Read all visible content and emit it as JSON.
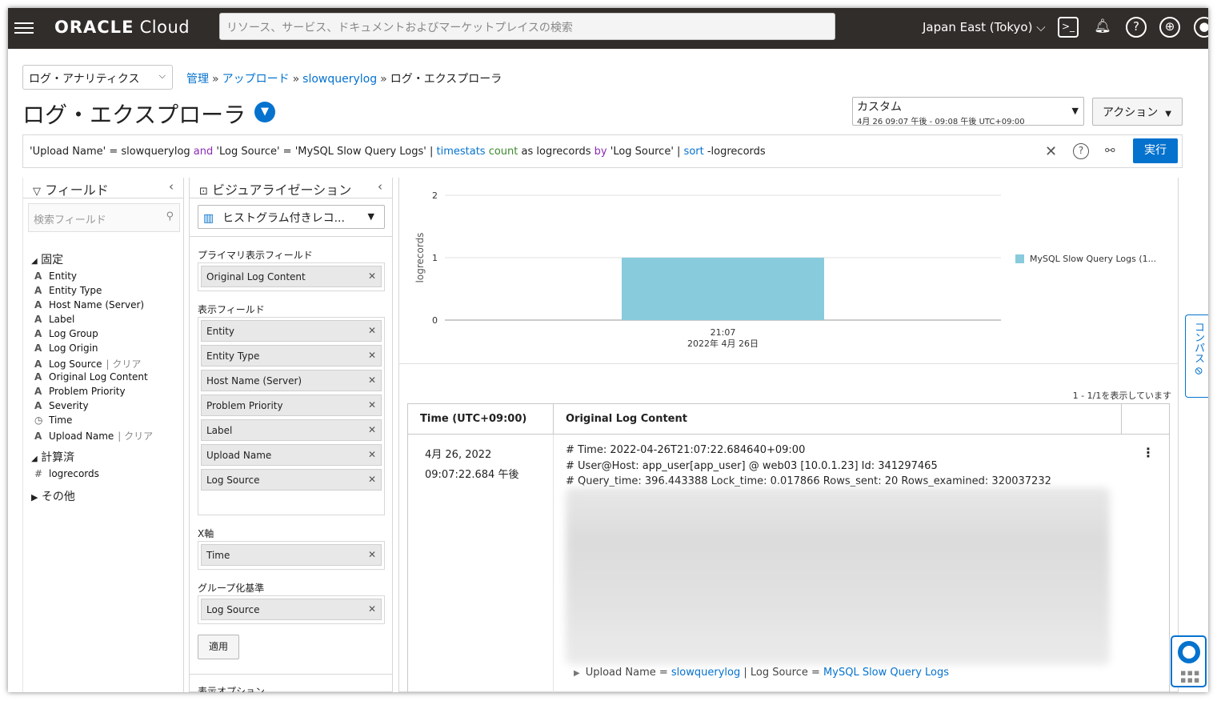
{
  "topbar": {
    "brand_bold": "ORACLE",
    "brand_rest": " Cloud",
    "search_placeholder": "リソース、サービス、ドキュメントおよびマーケットプレイスの検索",
    "region": "Japan East (Tokyo)",
    "icons": [
      "menu-icon",
      "cloud-shell-icon",
      "bell-icon",
      "help-icon",
      "globe-icon",
      "profile-icon"
    ]
  },
  "domain_select": "ログ・アナリティクス",
  "breadcrumb": {
    "items": [
      "管理",
      "アップロード",
      "slowquerylog"
    ],
    "current": "ログ・エクスプローラ",
    "separator": "»"
  },
  "page_title": "ログ・エクスプローラ",
  "time_range": {
    "label": "カスタム",
    "value": "4月 26 09:07 午後 - 09:08 午後 UTC+09:00"
  },
  "actions_label": "アクション",
  "query": {
    "p1": "'Upload Name' = slowquerylog ",
    "and": "and",
    "p2": " 'Log Source' = 'MySQL Slow Query Logs' | ",
    "timestats": "timestats",
    "count": "count",
    "as": " as ",
    "p3": "logrecords ",
    "by": "by",
    "p4": " 'Log Source' | ",
    "sort": "sort",
    "p5": " -logrecords",
    "run_label": "実行"
  },
  "fields_panel": {
    "title": "フィールド",
    "search_placeholder": "検索フィールド",
    "group_fixed": "固定",
    "fixed_fields": [
      {
        "type": "A",
        "name": "Entity",
        "extra": ""
      },
      {
        "type": "A",
        "name": "Entity Type",
        "extra": ""
      },
      {
        "type": "A",
        "name": "Host Name (Server)",
        "extra": ""
      },
      {
        "type": "A",
        "name": "Label",
        "extra": ""
      },
      {
        "type": "A",
        "name": "Log Group",
        "extra": ""
      },
      {
        "type": "A",
        "name": "Log Origin",
        "extra": ""
      },
      {
        "type": "A",
        "name": "Log Source",
        "extra": "| クリア"
      },
      {
        "type": "A",
        "name": "Original Log Content",
        "extra": ""
      },
      {
        "type": "A",
        "name": "Problem Priority",
        "extra": ""
      },
      {
        "type": "A",
        "name": "Severity",
        "extra": ""
      },
      {
        "type": "◷",
        "name": "Time",
        "extra": ""
      },
      {
        "type": "A",
        "name": "Upload Name",
        "extra": "| クリア"
      }
    ],
    "group_calc": "計算済",
    "calc_fields": [
      {
        "type": "#",
        "name": "logrecords"
      }
    ],
    "group_other": "その他"
  },
  "viz_panel": {
    "title": "ビジュアライゼーション",
    "select_value": "ヒストグラム付きレコ...",
    "primary_label": "プライマリ表示フィールド",
    "primary_fields": [
      "Original Log Content"
    ],
    "display_label": "表示フィールド",
    "display_fields": [
      "Entity",
      "Entity Type",
      "Host Name (Server)",
      "Problem Priority",
      "Label",
      "Upload Name",
      "Log Source"
    ],
    "xaxis_label": "X軸",
    "xaxis_fields": [
      "Time"
    ],
    "group_label": "グループ化基準",
    "group_fields": [
      "Log Source"
    ],
    "apply_label": "適用",
    "display_options_label": "表示オプション"
  },
  "chart_data": {
    "type": "bar",
    "categories": [
      "21:07"
    ],
    "category_sublabel": "2022年 4月 26日",
    "series": [
      {
        "name": "MySQL Slow Query Logs (1...",
        "values": [
          1
        ]
      }
    ],
    "ylabel": "logrecords",
    "yticks": [
      "0",
      "1",
      "2"
    ],
    "ylim": [
      0,
      2
    ],
    "color": "#87cbdc",
    "legend_position": "right"
  },
  "results": {
    "count_label": "1 - 1/1を表示しています",
    "col_time": "Time (UTC+09:00)",
    "col_content": "Original Log Content",
    "rows": [
      {
        "date": "4月 26, 2022",
        "time": "09:07:22.684 午後",
        "line1": "# Time: 2022-04-26T21:07:22.684640+09:00",
        "line2": "# User@Host: app_user[app_user] @ web03 [10.0.1.23]  Id: 341297465",
        "line3": "# Query_time: 396.443388  Lock_time: 0.017866 Rows_sent: 20  Rows_examined: 320037232",
        "meta_k1": "Upload Name = ",
        "meta_v1": "slowquerylog",
        "meta_k2": " | Log Source = ",
        "meta_v2": "MySQL Slow Query Logs"
      }
    ]
  },
  "compass_label": "コンパス"
}
